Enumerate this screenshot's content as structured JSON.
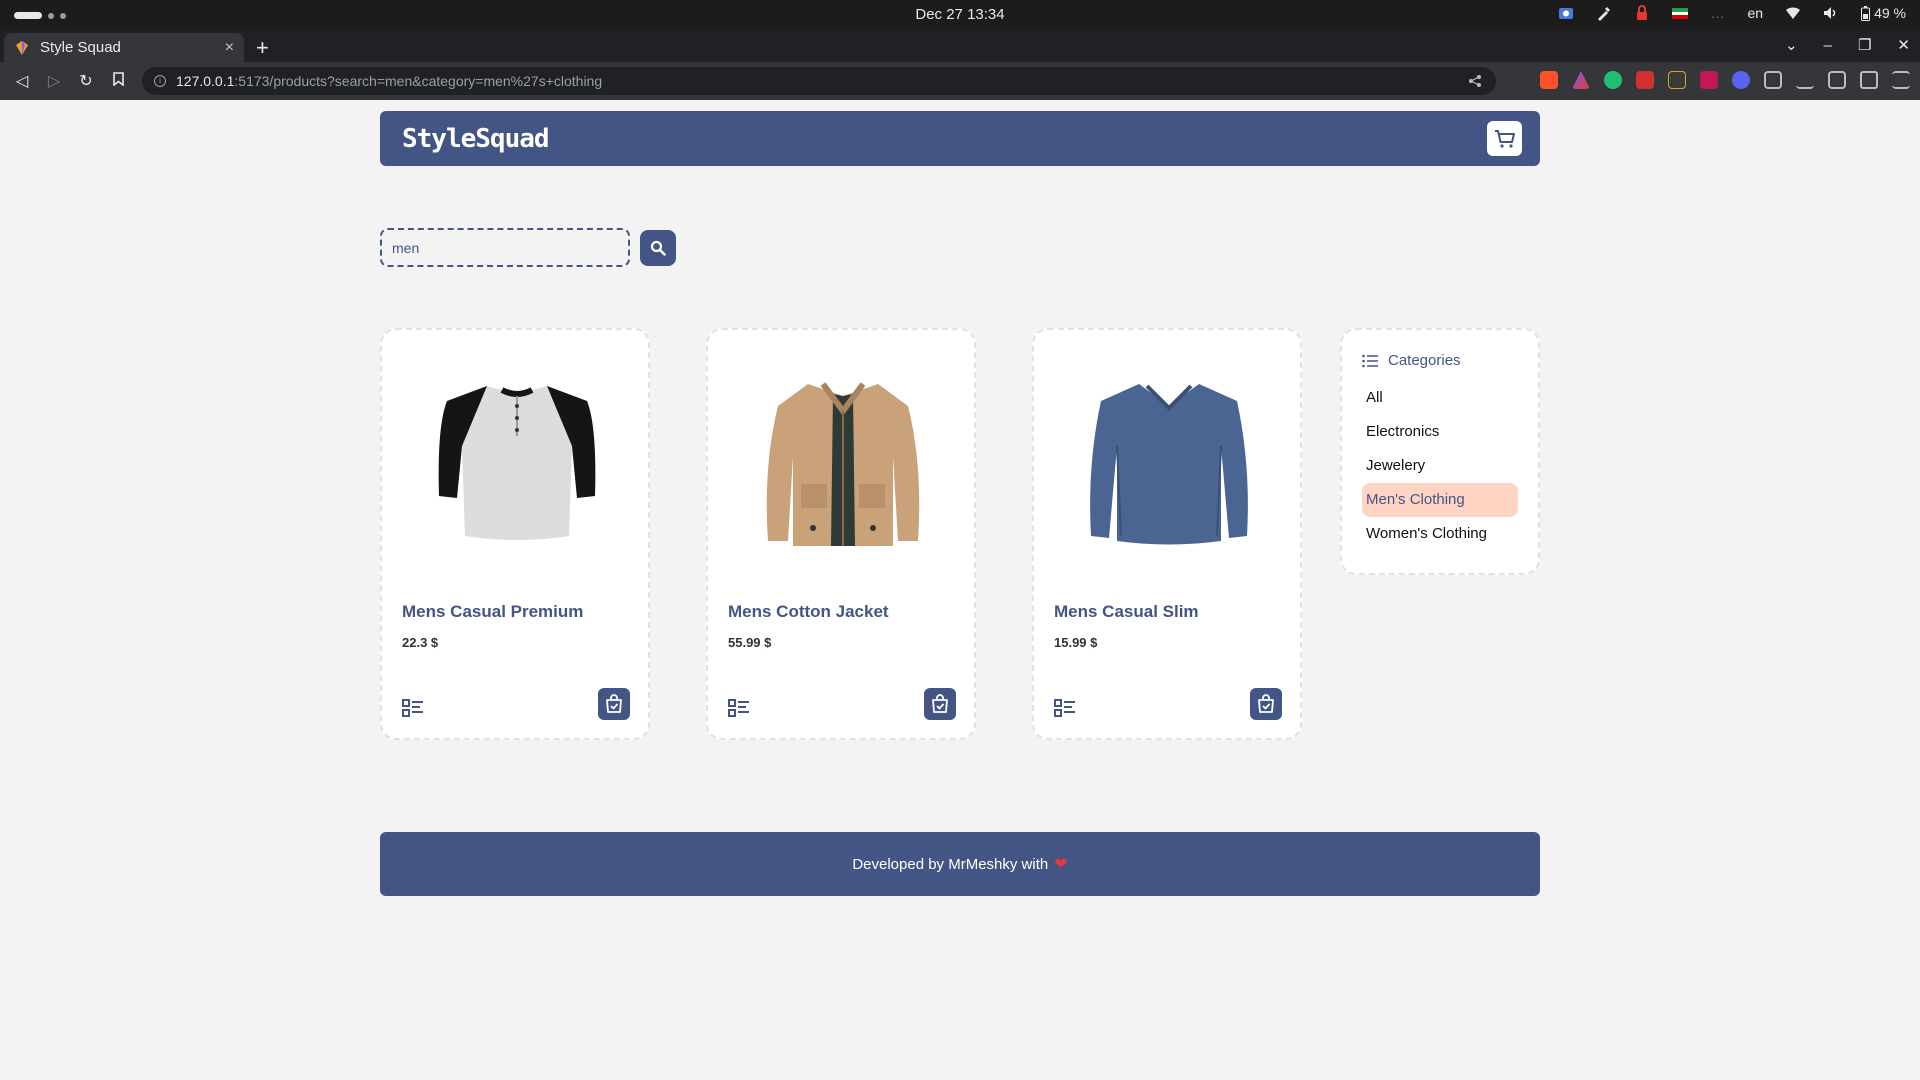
{
  "os": {
    "clock": "Dec 27  13:34",
    "lang": "en",
    "battery": "49 %"
  },
  "browser": {
    "tab_title": "Style Squad",
    "new_tab": "+",
    "close_tab": "×",
    "url_host": "127.0.0.1",
    "url_path": ":5173/products?search=men&category=men%27s+clothing"
  },
  "app": {
    "brand": "StyleSquad",
    "search": {
      "value": "men",
      "placeholder": ""
    },
    "products": [
      {
        "title": "Mens Casual Premium",
        "price": "22.3 $"
      },
      {
        "title": "Mens Cotton Jacket",
        "price": "55.99 $"
      },
      {
        "title": "Mens Casual Slim",
        "price": "15.99 $"
      }
    ],
    "categories": {
      "heading": "Categories",
      "items": [
        "All",
        "Electronics",
        "Jewelery",
        "Men's Clothing",
        "Women's Clothing"
      ],
      "active": "Men's Clothing"
    },
    "footer": {
      "text": "Developed by MrMeshky with",
      "heart": "❤"
    }
  },
  "colors": {
    "primary": "#435585",
    "active_category_bg": "#ffd4c3",
    "page_bg": "#f3f3f3"
  }
}
